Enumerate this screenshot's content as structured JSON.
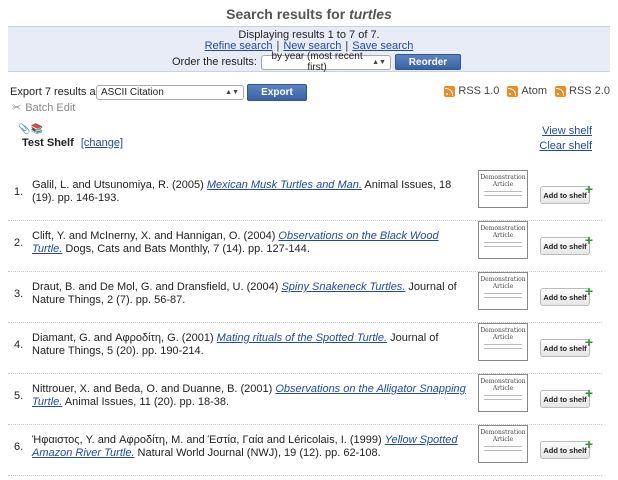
{
  "header": {
    "title_prefix": "Search results for",
    "query": "turtles"
  },
  "panel": {
    "displaying": "Displaying results 1 to 7 of 7.",
    "refine": "Refine search",
    "new_search": "New search",
    "save_search": "Save search",
    "separator": "|",
    "order_label": "Order the results:",
    "order_value": "by year (most recent first)",
    "reorder": "Reorder"
  },
  "export": {
    "label": "Export 7 results as",
    "format": "ASCII Citation",
    "button": "Export",
    "feeds": [
      "RSS 1.0",
      "Atom",
      "RSS 2.0"
    ]
  },
  "batch_edit": "Batch Edit",
  "shelf": {
    "name": "Test Shelf",
    "change": "[change]",
    "view": "View shelf",
    "clear": "Clear shelf"
  },
  "thumb": {
    "line1": "Demonstration",
    "line2": "Article"
  },
  "add_to_shelf": "Add to shelf",
  "results": [
    {
      "num": "1.",
      "authors": "Galil, L. and Utsunomiya, R. (2005) ",
      "title": "Mexican Musk Turtles and Man.",
      "rest": " Animal Issues, 18 (19). pp. 146-193."
    },
    {
      "num": "2.",
      "authors": "Clift, Y. and McInerny, X. and Hannigan, O. (2004) ",
      "title": "Observations on the Black Wood Turtle.",
      "rest": " Dogs, Cats and Bats Monthly, 7 (14). pp. 127-144."
    },
    {
      "num": "3.",
      "authors": "Draut, B. and De Mol, G. and Dransfield, U. (2004) ",
      "title": "Spiny Snakeneck Turtles.",
      "rest": " Journal of Nature Things, 2 (7). pp. 56-87."
    },
    {
      "num": "4.",
      "authors": "Diamant, G. and Αφροδίτη, G. (2001) ",
      "title": "Mating rituals of the Spotted Turtle.",
      "rest": " Journal of Nature Things, 5 (20). pp. 190-214."
    },
    {
      "num": "5.",
      "authors": "Nittrouer, X. and Beda, O. and Duanne, B. (2001) ",
      "title": "Observations on the Alligator Snapping Turtle.",
      "rest": " Animal Issues, 11 (20). pp. 18-38."
    },
    {
      "num": "6.",
      "authors": "Ήφαιστος, Y. and Αφροδίτη, M. and Έστία, Γαία and Léricolais, I. (1999) ",
      "title": "Yellow Spotted Amazon River Turtle.",
      "rest": " Natural World Journal (NWJ), 19 (12). pp. 62-108."
    }
  ]
}
